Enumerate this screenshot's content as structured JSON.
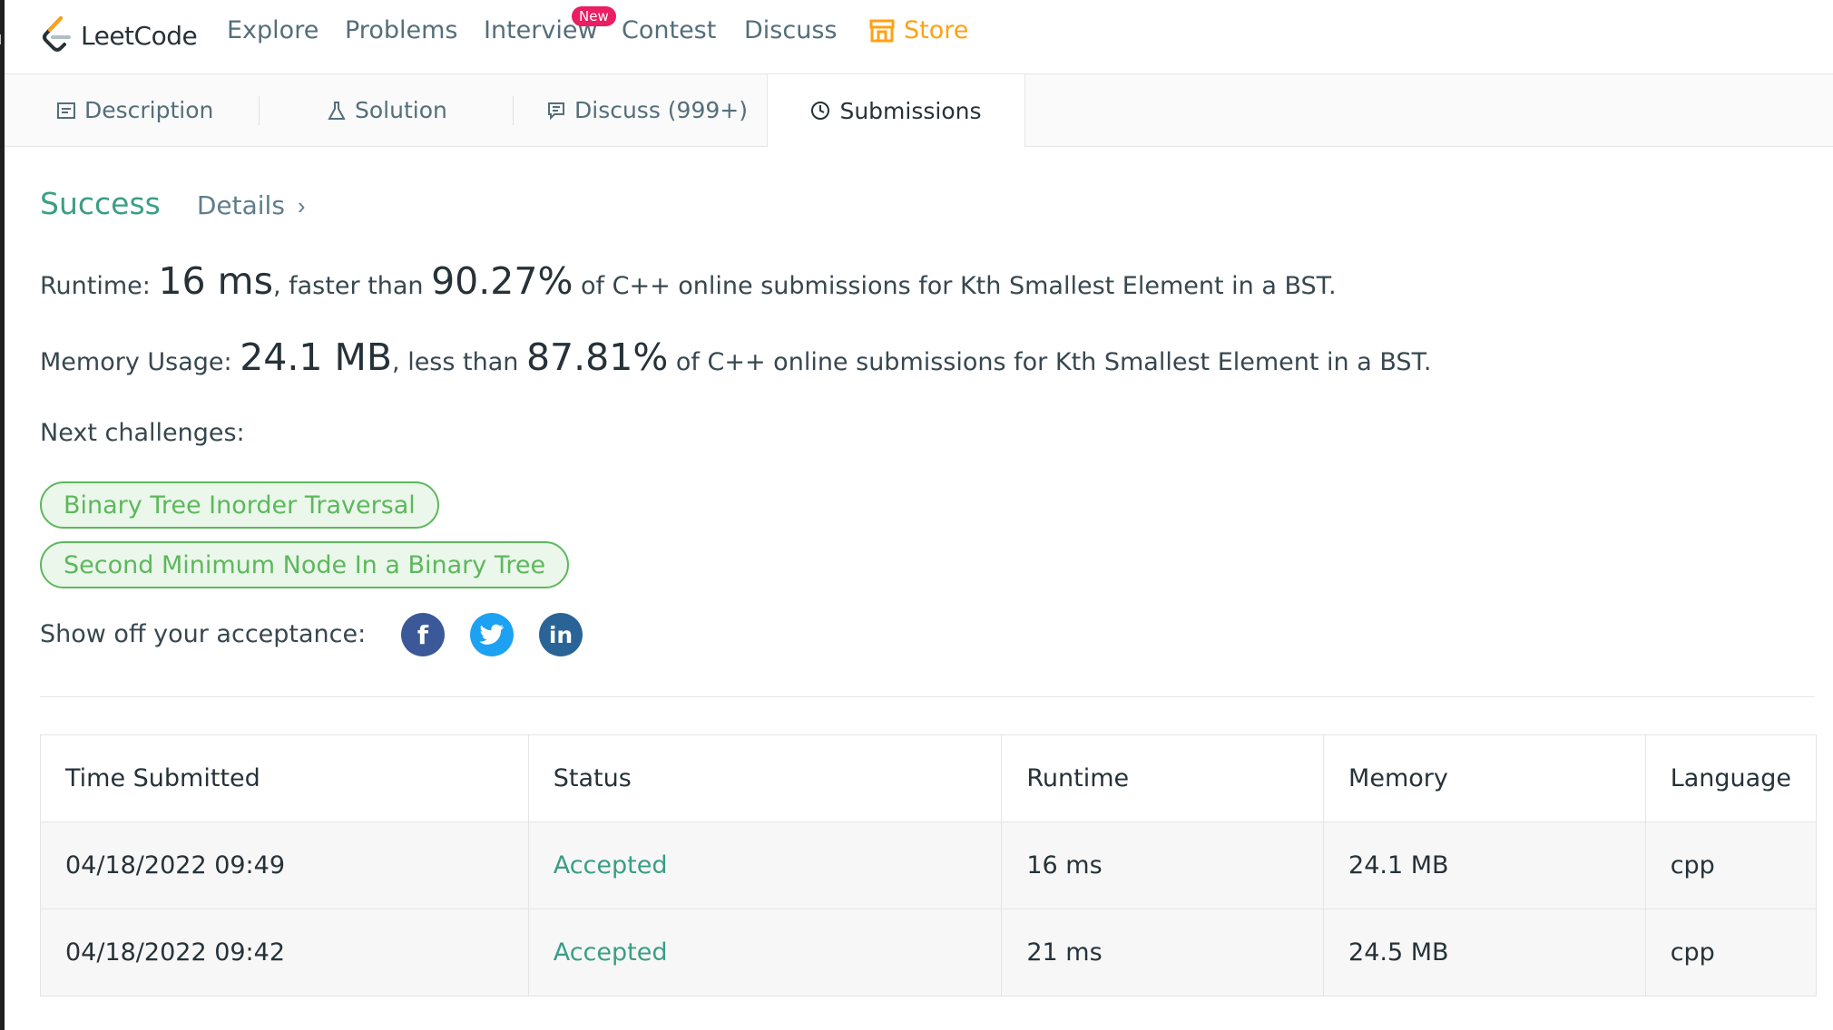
{
  "nav": {
    "logo_text": "LeetCode",
    "items": [
      "Explore",
      "Problems",
      "Interview",
      "Contest",
      "Discuss"
    ],
    "new_badge": "New",
    "store": "Store"
  },
  "tabs": {
    "description": "Description",
    "solution": "Solution",
    "discuss": "Discuss (999+)",
    "submissions": "Submissions"
  },
  "result": {
    "status": "Success",
    "details": "Details",
    "runtime_label": "Runtime: ",
    "runtime_value": "16 ms",
    "runtime_mid": ", faster than ",
    "runtime_pct": "90.27%",
    "runtime_tail": " of C++ online submissions for Kth Smallest Element in a BST.",
    "memory_label": "Memory Usage: ",
    "memory_value": "24.1 MB",
    "memory_mid": ", less than ",
    "memory_pct": "87.81%",
    "memory_tail": " of C++ online submissions for Kth Smallest Element in a BST."
  },
  "next": {
    "label": "Next challenges:",
    "challenges": [
      "Binary Tree Inorder Traversal",
      "Second Minimum Node In a Binary Tree"
    ]
  },
  "share": {
    "label": "Show off your acceptance:",
    "icons": [
      "facebook-icon",
      "twitter-icon",
      "linkedin-icon"
    ],
    "colors": {
      "facebook": "#3b5998",
      "twitter": "#1da1f2",
      "linkedin": "#2a6496"
    }
  },
  "table": {
    "headers": [
      "Time Submitted",
      "Status",
      "Runtime",
      "Memory",
      "Language"
    ],
    "rows": [
      [
        "04/18/2022 09:49",
        "Accepted",
        "16 ms",
        "24.1 MB",
        "cpp"
      ],
      [
        "04/18/2022 09:42",
        "Accepted",
        "21 ms",
        "24.5 MB",
        "cpp"
      ]
    ]
  },
  "colors": {
    "accent": "#ffa116",
    "success": "#3a9e85",
    "challenge": "#5cb85c"
  }
}
